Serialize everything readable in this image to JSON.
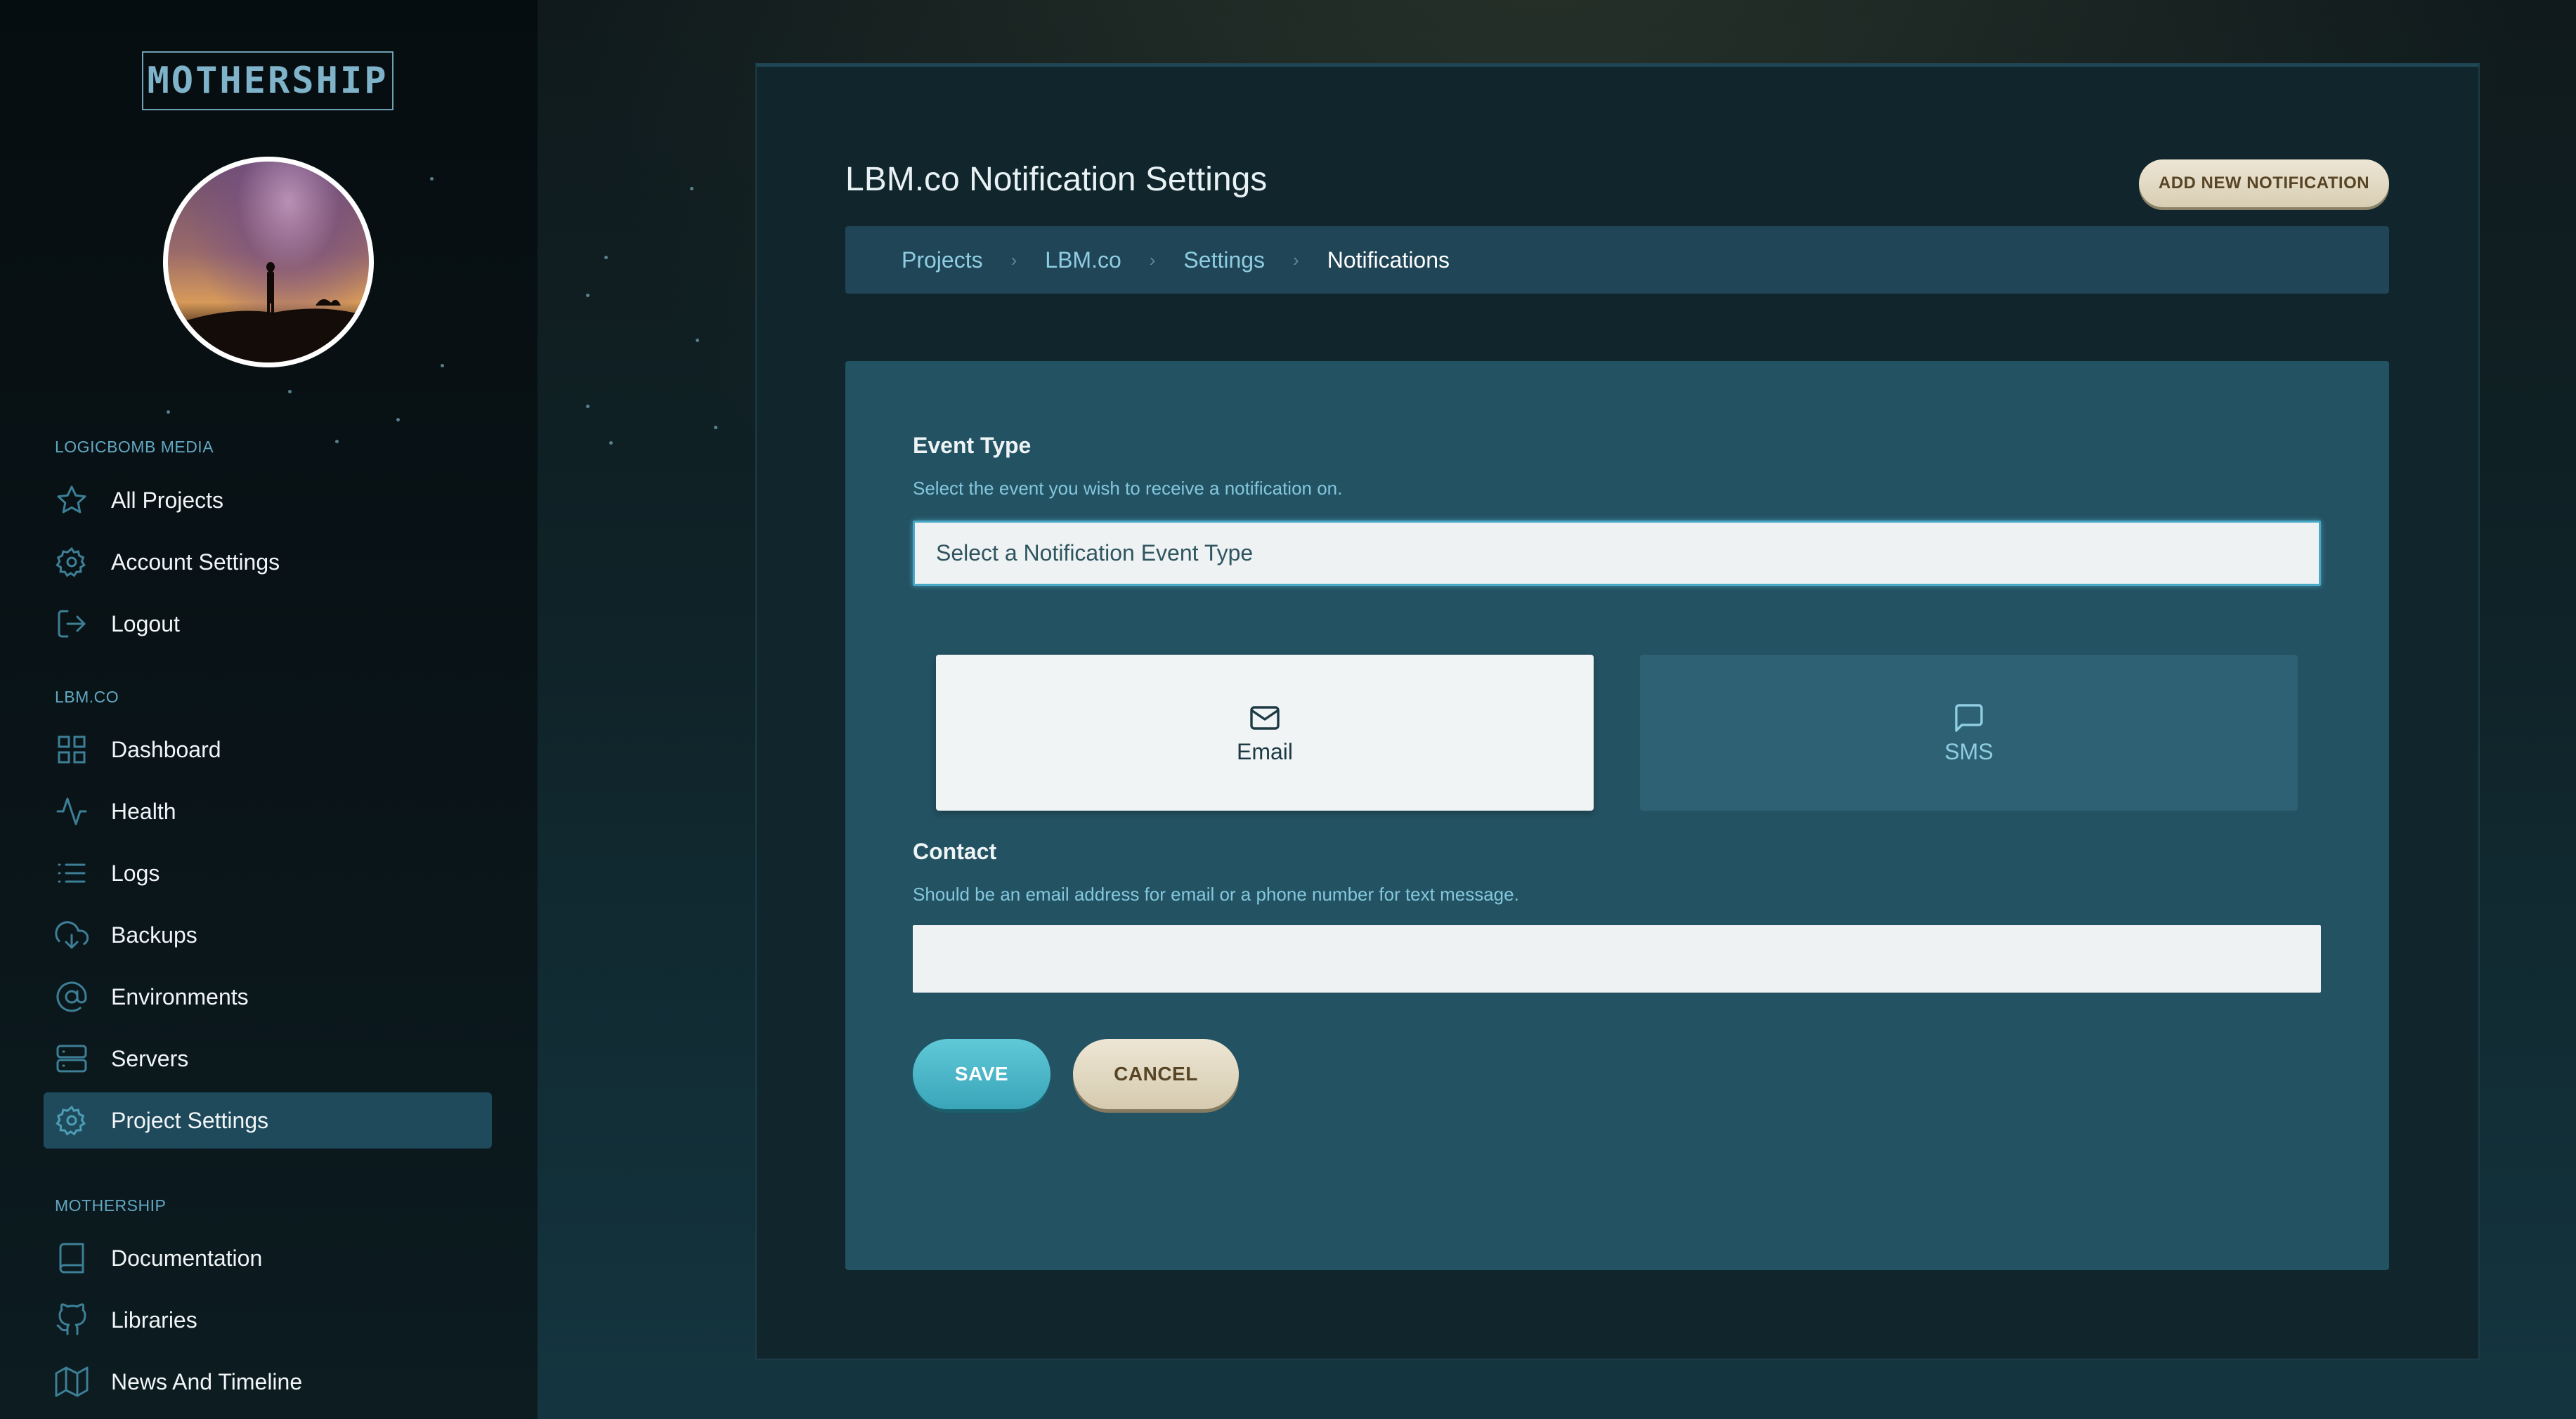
{
  "brand": {
    "logo_text": "MOTHERSHIP"
  },
  "sidebar": {
    "sections": [
      {
        "title": "LOGICBOMB MEDIA",
        "items": [
          {
            "label": "All Projects",
            "icon": "star-icon"
          },
          {
            "label": "Account Settings",
            "icon": "gear-icon"
          },
          {
            "label": "Logout",
            "icon": "logout-icon"
          }
        ]
      },
      {
        "title": "LBM.CO",
        "items": [
          {
            "label": "Dashboard",
            "icon": "grid-icon"
          },
          {
            "label": "Health",
            "icon": "activity-icon"
          },
          {
            "label": "Logs",
            "icon": "list-icon"
          },
          {
            "label": "Backups",
            "icon": "cloud-download-icon"
          },
          {
            "label": "Environments",
            "icon": "at-sign-icon"
          },
          {
            "label": "Servers",
            "icon": "server-icon"
          },
          {
            "label": "Project Settings",
            "icon": "gear-icon",
            "active": true
          }
        ]
      },
      {
        "title": "MOTHERSHIP",
        "items": [
          {
            "label": "Documentation",
            "icon": "book-icon"
          },
          {
            "label": "Libraries",
            "icon": "github-icon"
          },
          {
            "label": "News And Timeline",
            "icon": "map-icon"
          }
        ]
      }
    ]
  },
  "header": {
    "title": "LBM.co Notification Settings",
    "add_button": "ADD NEW NOTIFICATION"
  },
  "breadcrumb": [
    "Projects",
    "LBM.co",
    "Settings",
    "Notifications"
  ],
  "form": {
    "event_type": {
      "label": "Event Type",
      "help": "Select the event you wish to receive a notification on.",
      "selected": "Select a Notification Event Type"
    },
    "channels": [
      {
        "label": "Email",
        "icon": "mail-icon",
        "selected": true
      },
      {
        "label": "SMS",
        "icon": "message-square-icon",
        "selected": false
      }
    ],
    "contact": {
      "label": "Contact",
      "help": "Should be an email address for email or a phone number for text message.",
      "value": ""
    },
    "save_label": "SAVE",
    "cancel_label": "CANCEL"
  },
  "colors": {
    "accent": "#4ab8cc",
    "sidebar_active": "#1f4a5c",
    "panel": "#235262",
    "button_tan": "#e4dcc6"
  }
}
